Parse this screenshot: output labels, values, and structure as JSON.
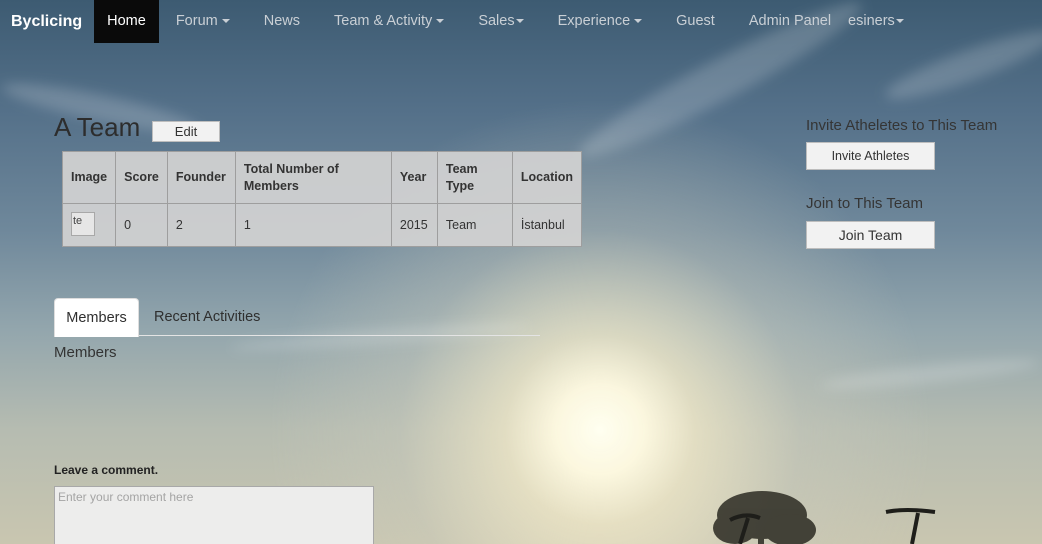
{
  "navbar": {
    "brand": "Byclicing",
    "items": [
      {
        "label": "Home",
        "active": true,
        "dropdown": false
      },
      {
        "label": "Forum",
        "active": false,
        "dropdown": true
      },
      {
        "label": "News",
        "active": false,
        "dropdown": false
      },
      {
        "label": "Team & Activity",
        "active": false,
        "dropdown": true
      },
      {
        "label": "Sales",
        "active": false,
        "dropdown": true
      },
      {
        "label": "Experience",
        "active": false,
        "dropdown": true
      },
      {
        "label": "Guest",
        "active": false,
        "dropdown": false
      },
      {
        "label": "Admin Panel",
        "active": false,
        "dropdown": false
      },
      {
        "label": "esiners",
        "active": false,
        "dropdown": true
      }
    ]
  },
  "team": {
    "title": "A Team",
    "edit_label": "Edit"
  },
  "info_table": {
    "headers": [
      "Image",
      "Score",
      "Founder",
      "Total Number of Members",
      "Year",
      "Team Type",
      "Location"
    ],
    "row": {
      "image_alt": "te",
      "score": "0",
      "founder": "2",
      "total_members": "1",
      "year": "2015",
      "team_type": "Team",
      "location": "İstanbul"
    }
  },
  "invite": {
    "heading": "Invite Atheletes to This Team",
    "button_label": "Invite Athletes"
  },
  "join": {
    "heading": "Join to This Team",
    "button_label": "Join Team"
  },
  "tabs": [
    {
      "label": "Members",
      "active": true
    },
    {
      "label": "Recent Activities",
      "active": false
    }
  ],
  "members_heading": "Members",
  "comment": {
    "label": "Leave a comment.",
    "placeholder": "Enter your comment here"
  },
  "colors": {
    "nav_active_bg": "#0a0a0a",
    "table_bg": "#d2d2d2",
    "sky_top": "#3d5b72",
    "sky_bottom": "#c9c6b0"
  }
}
